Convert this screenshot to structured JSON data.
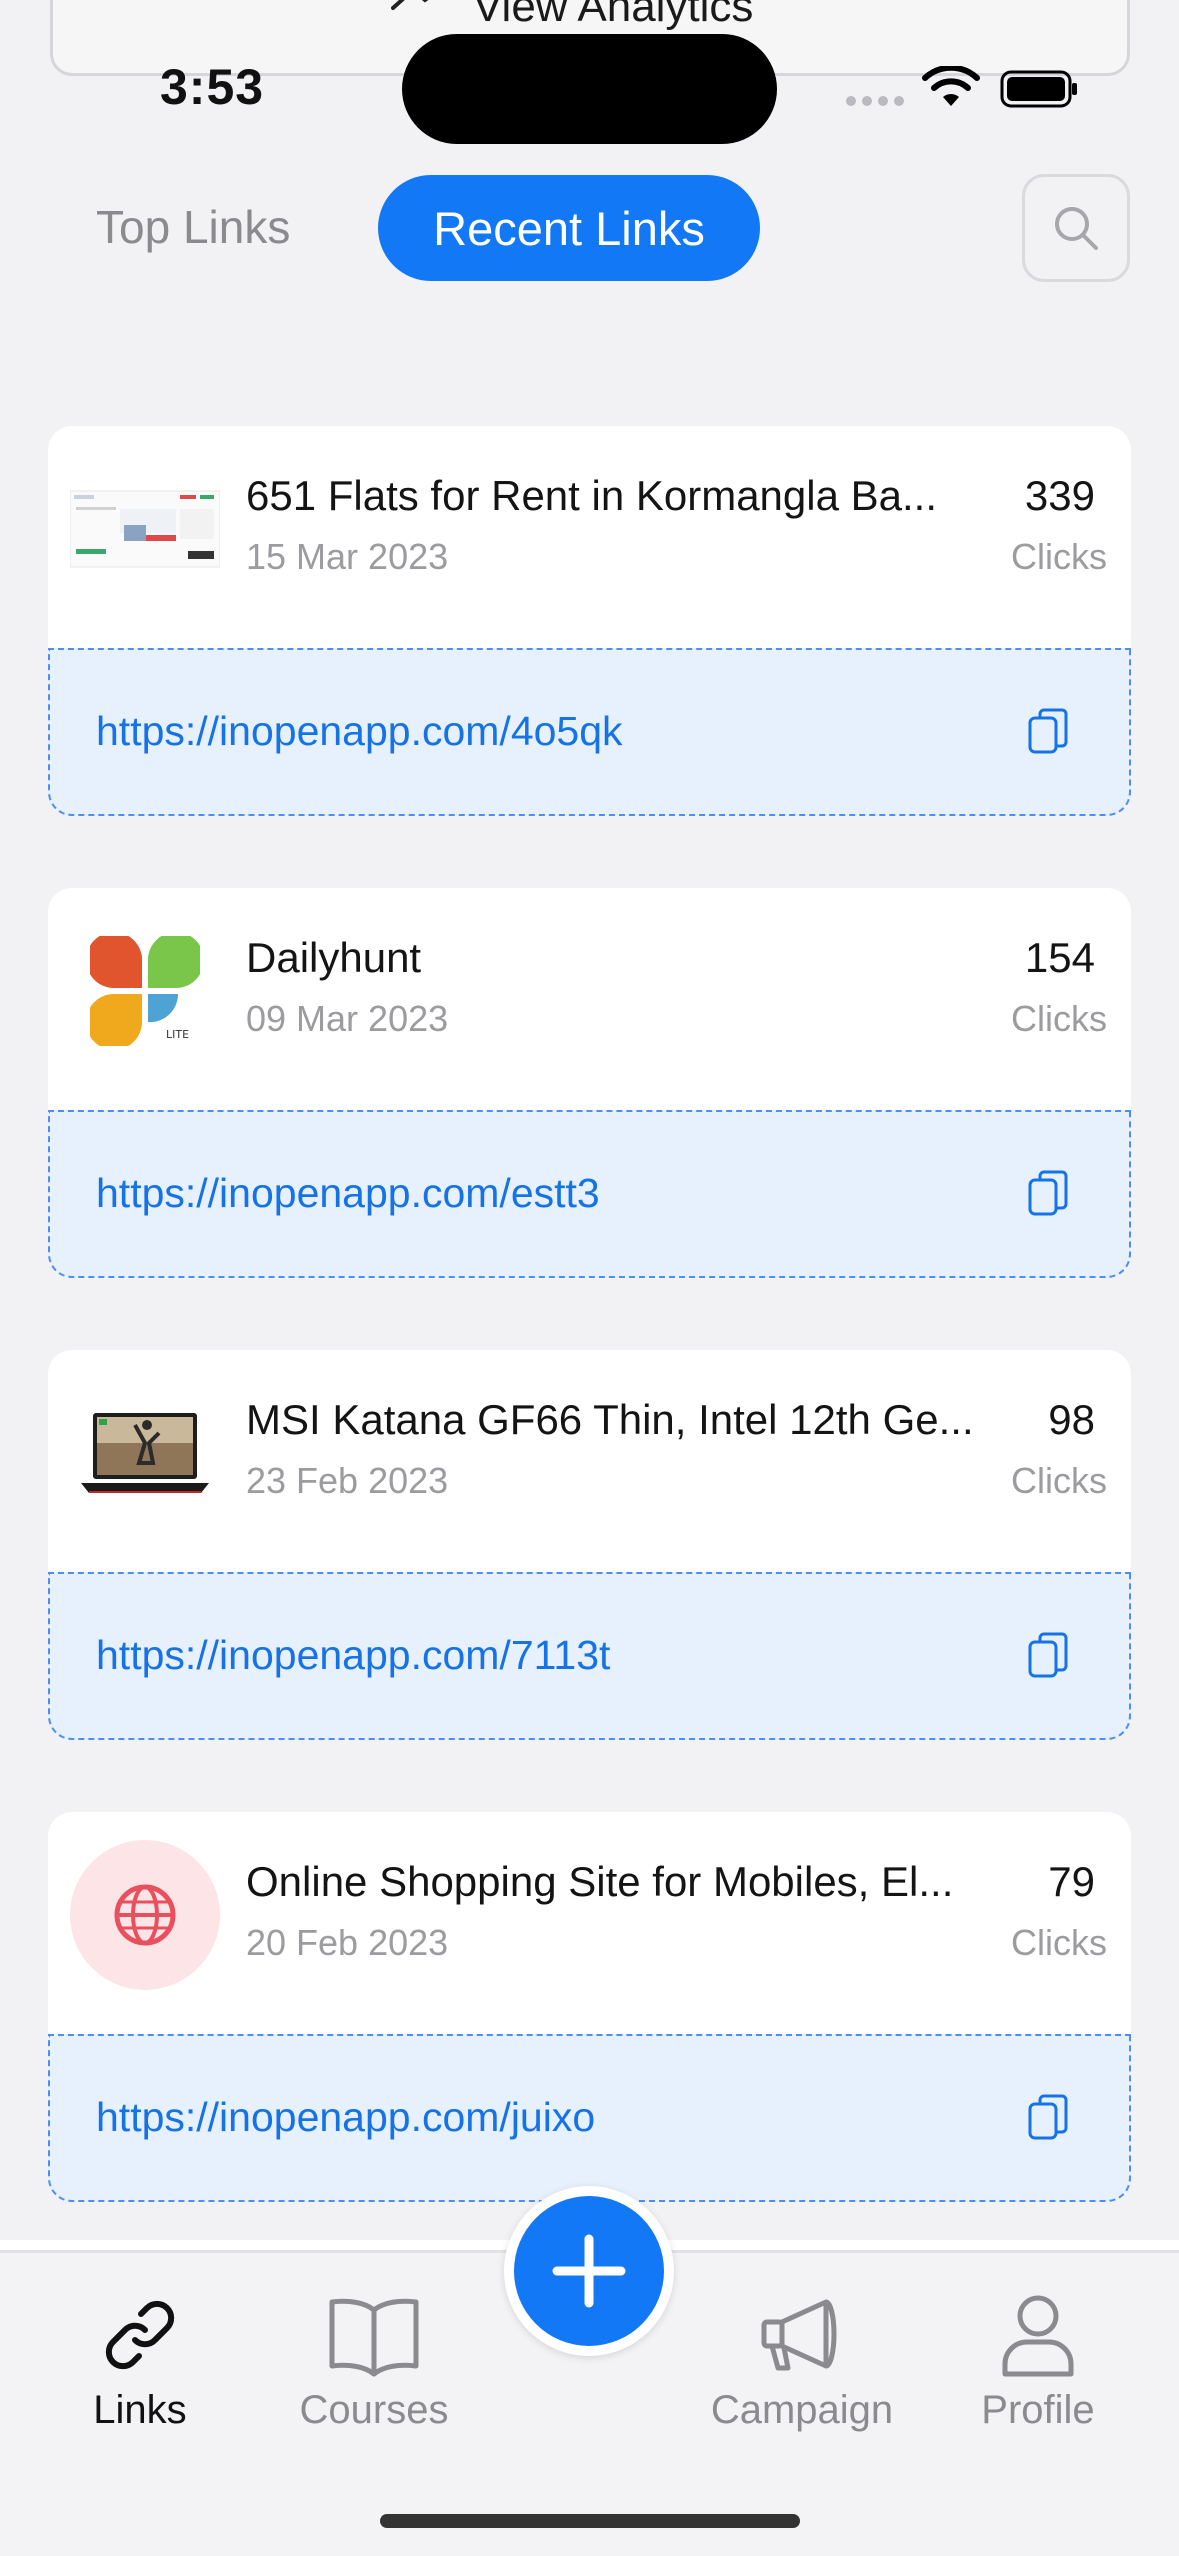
{
  "status_bar": {
    "time": "3:53"
  },
  "peek": {
    "label": "View Analytics"
  },
  "tabs": {
    "top": "Top Links",
    "recent": "Recent Links"
  },
  "links": [
    {
      "title": "651   Flats for Rent in Kormangla Ba...",
      "date": "15 Mar 2023",
      "count": "339",
      "clicks_label": "Clicks",
      "url": "https://inopenapp.com/4o5qk"
    },
    {
      "title": "Dailyhunt",
      "date": "09 Mar 2023",
      "count": "154",
      "clicks_label": "Clicks",
      "url": "https://inopenapp.com/estt3"
    },
    {
      "title": "MSI Katana GF66 Thin, Intel 12th Ge...",
      "date": "23 Feb 2023",
      "count": "98",
      "clicks_label": "Clicks",
      "url": "https://inopenapp.com/7113t"
    },
    {
      "title": "Online Shopping Site for Mobiles, El...",
      "date": "20 Feb 2023",
      "count": "79",
      "clicks_label": "Clicks",
      "url": "https://inopenapp.com/juixo"
    }
  ],
  "nav": {
    "links": "Links",
    "courses": "Courses",
    "campaign": "Campaign",
    "profile": "Profile"
  },
  "colors": {
    "accent": "#1278f5",
    "link_text": "#1673e6",
    "link_bg": "#e7f0fd"
  }
}
